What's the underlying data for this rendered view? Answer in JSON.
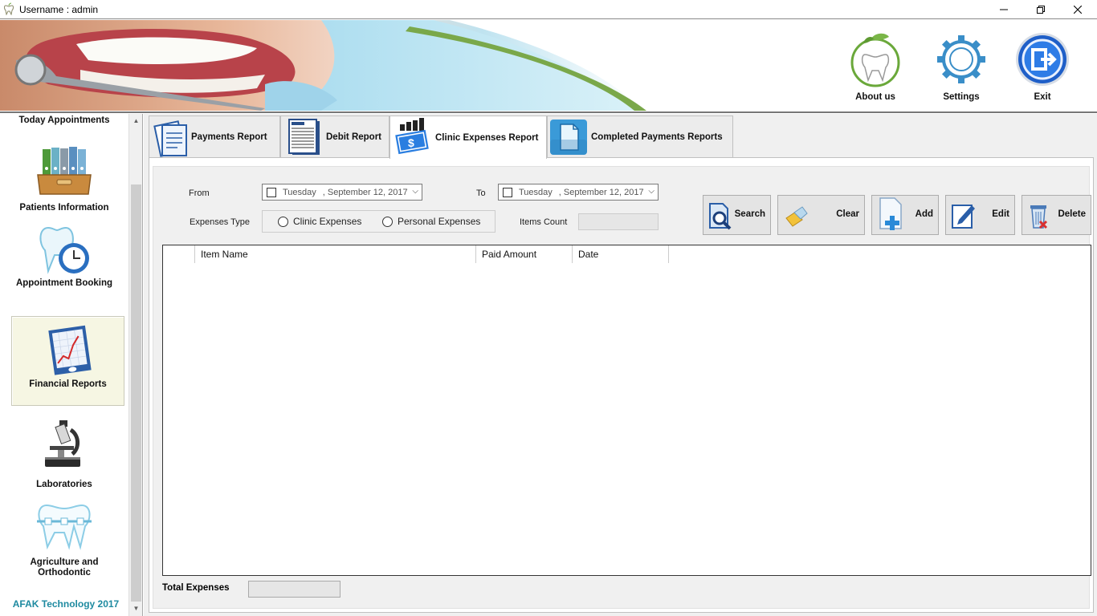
{
  "window": {
    "title": "Username : admin",
    "controls": [
      "minimize",
      "maximize",
      "close"
    ]
  },
  "header": {
    "about_label": "About us",
    "settings_label": "Settings",
    "exit_label": "Exit"
  },
  "sidebar": {
    "items": [
      {
        "label": "Today Appointments",
        "icon": "calendar-icon"
      },
      {
        "label": "Patients Information",
        "icon": "binders-icon"
      },
      {
        "label": "Appointment Booking",
        "icon": "tooth-clock-icon"
      },
      {
        "label": "Financial Reports",
        "icon": "chart-book-icon",
        "selected": true
      },
      {
        "label": "Laboratories",
        "icon": "microscope-icon"
      },
      {
        "label": "Agriculture and Orthodontic",
        "icon": "braces-tooth-icon"
      }
    ],
    "footer": "AFAK Technology 2017"
  },
  "tabs": [
    {
      "label": "Payments Report",
      "icon": "notepad-icon"
    },
    {
      "label": "Debit Report",
      "icon": "report-icon"
    },
    {
      "label": "Clinic Expenses Report",
      "icon": "money-chart-icon",
      "active": true
    },
    {
      "label": "Completed Payments Reports",
      "icon": "document-icon"
    }
  ],
  "filters": {
    "from_label": "From",
    "to_label": "To",
    "from_date": {
      "day": "Tuesday",
      "date": ", September 12, 2017"
    },
    "to_date": {
      "day": "Tuesday",
      "date": ", September 12, 2017"
    },
    "expenses_type_label": "Expenses Type",
    "radio_clinic": "Clinic Expenses",
    "radio_personal": "Personal Expenses",
    "items_count_label": "Items Count",
    "items_count_value": ""
  },
  "actions": {
    "search": "Search",
    "clear": "Clear",
    "add": "Add",
    "edit": "Edit",
    "delete": "Delete"
  },
  "grid": {
    "columns": [
      "",
      "Item Name",
      "Paid Amount",
      "Date"
    ],
    "rows": []
  },
  "totals": {
    "label": "Total Expenses",
    "value": ""
  },
  "colors": {
    "brand_footer": "#1e8aa0",
    "selected_nav_bg": "#f6f6e3",
    "tab_bg": "#ececec"
  }
}
